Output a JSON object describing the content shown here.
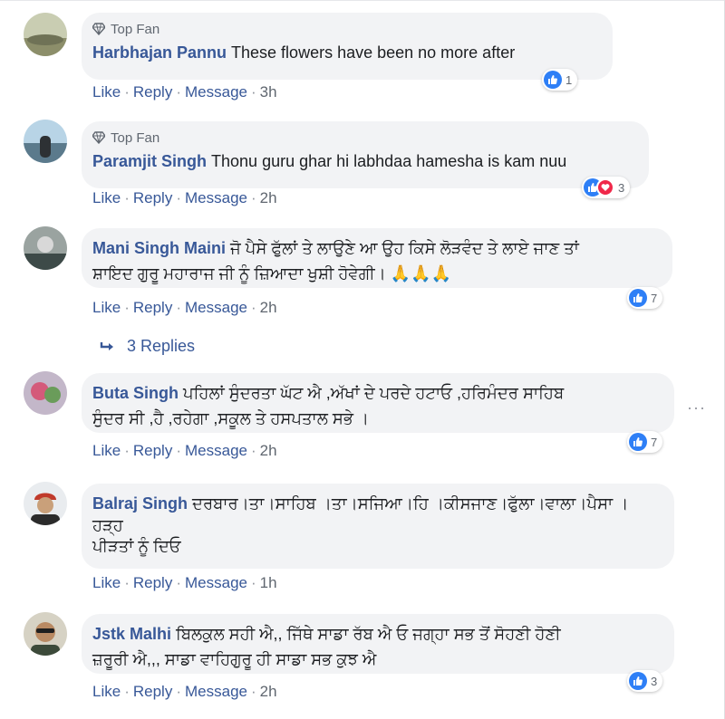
{
  "labels": {
    "top_fan": "Top Fan",
    "like": "Like",
    "reply": "Reply",
    "message": "Message",
    "sep": "·",
    "replies": "3 Replies",
    "more": "···"
  },
  "comments": [
    {
      "author": "Harbhajan Pannu",
      "top_fan": true,
      "lines": [
        "These flowers have been no more after"
      ],
      "time": "3h",
      "reactions": 1,
      "reaction_types": [
        "like"
      ]
    },
    {
      "author": "Paramjit Singh",
      "top_fan": true,
      "lines": [
        "Thonu guru ghar hi labhdaa hamesha is kam nuu"
      ],
      "time": "2h",
      "reactions": 3,
      "reaction_types": [
        "like",
        "love"
      ]
    },
    {
      "author": "Mani Singh Maini",
      "top_fan": false,
      "lines": [
        "ਜੋ ਪੈਸੇ ਫੁੱਲਾਂ ਤੇ ਲਾਉਣੇ ਆ ਉਹ ਕਿਸੇ ਲੋੜਵੰਦ ਤੇ ਲਾਏ ਜਾਣ ਤਾਂ",
        "ਸ਼ਾਇਦ ਗੁਰੂ ਮਹਾਰਾਜ ਜੀ ਨੂੰ ਜ਼ਿਆਦਾ ਖੁਸ਼ੀ ਹੋਵੇਗੀ। 🙏🙏🙏"
      ],
      "time": "2h",
      "reactions": 7,
      "reaction_types": [
        "like"
      ]
    },
    {
      "author": "Buta Singh",
      "top_fan": false,
      "lines": [
        "ਪਹਿਲਾਂ ਸੁੰਦਰਤਾ ਘੱਟ ਐ ,ਅੱਖਾਂ ਦੇ ਪਰਦੇ ਹਟਾਓ ,ਹਰਿਮੰਦਰ ਸਾਹਿਬ",
        "ਸੁੰਦਰ ਸੀ ,ਹੈ ,ਰਹੇਗਾ ,ਸਕੂਲ ਤੇ ਹਸਪਤਾਲ ਸਭੇ ।"
      ],
      "time": "2h",
      "reactions": 7,
      "reaction_types": [
        "like"
      ]
    },
    {
      "author": "Balraj Singh",
      "top_fan": false,
      "lines": [
        "ਦਰਬਾਰ।ਤਾ।ਸਾਹਿਬ ।ਤਾ।ਸਜਿਆ।ਹਿ ।ਕੀਸਜਾਣ।ਫੁੱਲਾ।ਵਾਲਾ।ਪੈਸਾ ।",
        "ਹੜ੍ਹ",
        "ਪੀੜਤਾਂ ਨੂੰ ਦਿਓ"
      ],
      "time": "1h",
      "reactions": null,
      "reaction_types": []
    },
    {
      "author": "Jstk Malhi",
      "top_fan": false,
      "lines": [
        "ਬਿਲਕੁਲ ਸਹੀ ਐ,, ਜਿੱਥੇ ਸਾਡਾ ਰੱਬ ਐ ਓ ਜਗ੍ਹਾ ਸਭ ਤੋਂ ਸੋਹਣੀ ਹੋਣੀ",
        "ਜ਼ਰੂਰੀ ਐ,,, ਸਾਡਾ ਵਾਹਿਗੁਰੂ ਹੀ ਸਾਡਾ ਸਭ ਕੁਝ ਐ"
      ],
      "time": "2h",
      "reactions": 3,
      "reaction_types": [
        "like"
      ]
    }
  ]
}
